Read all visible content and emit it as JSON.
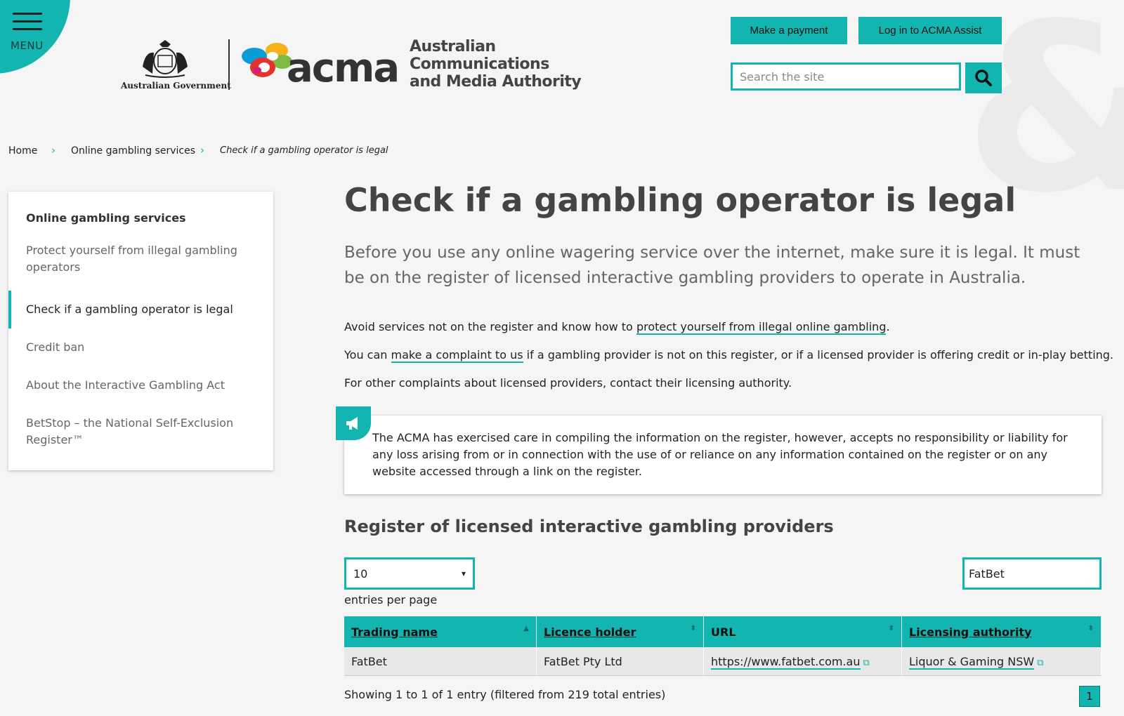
{
  "menu": {
    "label": "MENU"
  },
  "header": {
    "gov_text": "Australian Government",
    "acma_word": "acma",
    "acma_full": [
      "Australian",
      "Communications",
      "and Media Authority"
    ],
    "make_payment": "Make a payment",
    "login": "Log in to ACMA Assist",
    "search_placeholder": "Search the site"
  },
  "breadcrumb": {
    "items": [
      "Home",
      "Online gambling services",
      "Check if a gambling operator is legal"
    ]
  },
  "sidenav": {
    "title": "Online gambling services",
    "items": [
      "Protect yourself from illegal gambling operators",
      "Check if a gambling operator is legal",
      "Credit ban",
      "About the Interactive Gambling Act",
      "BetStop – the National Self-Exclusion Register™"
    ]
  },
  "main": {
    "title": "Check if a gambling operator is legal",
    "lead": "Before you use any online wagering service over the internet, make sure it is legal. It must be on the register of licensed interactive gambling providers to operate in Australia.",
    "p1_pre": "Avoid services not on the register and know how to ",
    "p1_link": "protect yourself from illegal online gambling",
    "p1_post": ".",
    "p2_pre": "You can ",
    "p2_link": "make a complaint to us",
    "p2_post": " if a gambling provider is not on this register, or if a licensed provider is offering credit or in-play betting.",
    "p3": "For other complaints about licensed providers, contact their licensing authority.",
    "callout": "The ACMA has exercised care in compiling the information on the register, however, accepts no responsibility or liability for any loss arising from or in connection with the use of or reliance on any information contained on the register or on any website accessed through a link on the register.",
    "section_title": "Register of licensed interactive gambling providers",
    "page_size": "10",
    "entries_label": "entries per page",
    "filter_value": "FatBet"
  },
  "table": {
    "headers": [
      "Trading name",
      "Licence holder",
      "URL",
      "Licensing authority"
    ],
    "rows": [
      [
        "FatBet",
        "FatBet Pty Ltd",
        "https://www.fatbet.com.au",
        "Liquor & Gaming NSW"
      ]
    ],
    "showing": "Showing 1 to 1 of 1 entry (filtered from 219 total entries)",
    "current_page": "1"
  },
  "colors": {
    "accent": "#13b5b1",
    "background": "#f5f5f5"
  },
  "icons": [
    "menu-icon",
    "search-icon",
    "megaphone-icon",
    "external-link-icon",
    "sort-icon"
  ]
}
